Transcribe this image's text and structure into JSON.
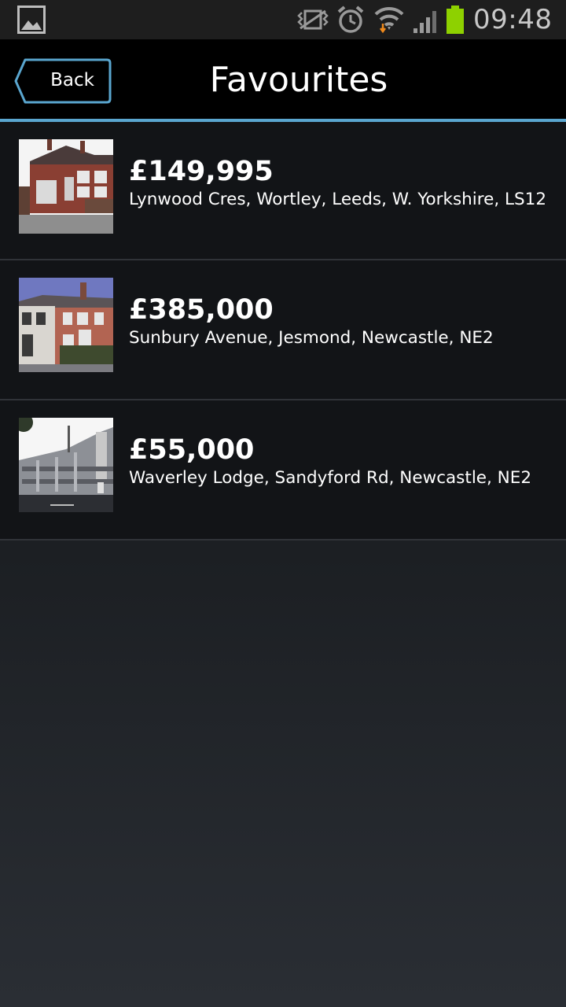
{
  "status_bar": {
    "time": "09:48",
    "icons": [
      "gallery-icon",
      "vibrate-icon",
      "alarm-icon",
      "wifi-icon",
      "signal-icon",
      "battery-icon"
    ],
    "battery_color": "#8ed100"
  },
  "header": {
    "back_label": "Back",
    "title": "Favourites",
    "accent_color": "#5aa6cf"
  },
  "favourites": [
    {
      "price": "£149,995",
      "address": "Lynwood Cres, Wortley, Leeds, W. Yorkshire, LS12"
    },
    {
      "price": "£385,000",
      "address": "Sunbury Avenue, Jesmond, Newcastle, NE2"
    },
    {
      "price": "£55,000",
      "address": "Waverley Lodge, Sandyford Rd, Newcastle, NE2"
    }
  ]
}
